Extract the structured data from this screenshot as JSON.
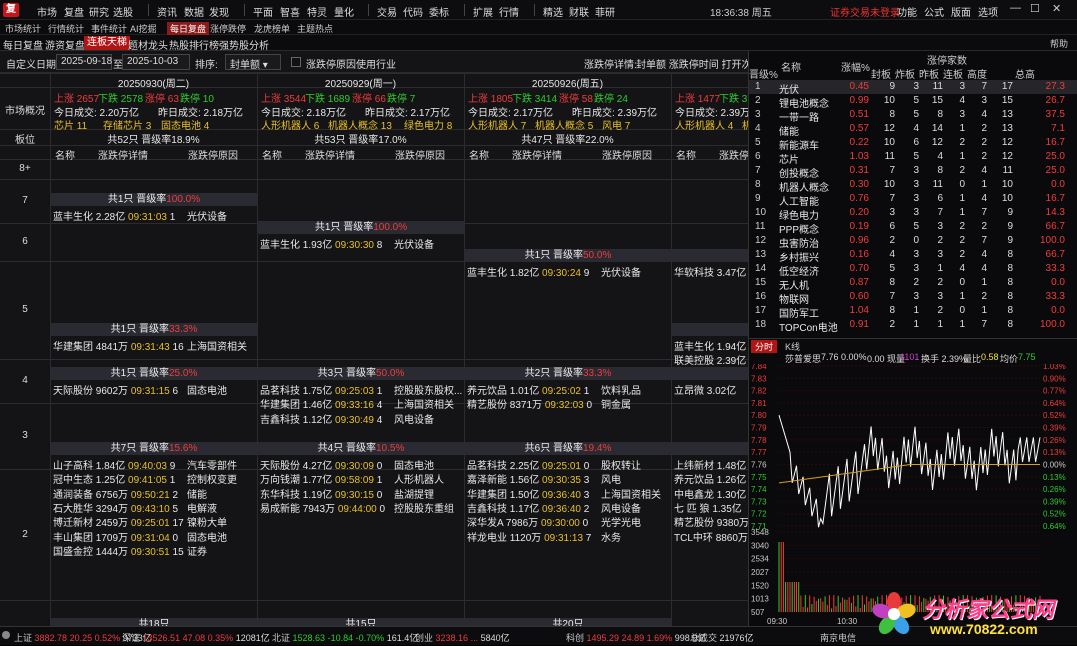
{
  "app": {
    "logo": "复"
  },
  "menubar": {
    "items": [
      "市场",
      "复盘",
      "研究",
      "选股",
      "资讯",
      "数据",
      "发现",
      "平面",
      "智喜",
      "特灵",
      "量化",
      "交易",
      "代码",
      "委标",
      "扩展",
      "行情",
      "精选",
      "财联",
      "菲研"
    ],
    "clock": "18:36:38 周五",
    "login": "证券交易未登录",
    "right": [
      "功能",
      "公式",
      "版面",
      "选项"
    ]
  },
  "subbar": {
    "items": [
      "市场统计",
      "行情统计",
      "事件统计",
      "AI挖掘",
      "每日复盘",
      "涨停跌停",
      "龙虎榜单",
      "主题热点"
    ],
    "active": 4
  },
  "tabbar": {
    "items": [
      "每日复盘",
      "游资复盘",
      "连板天梯",
      "题材龙头",
      "热股排行榜",
      "强势股分析"
    ],
    "active": 2,
    "help": "帮助"
  },
  "filter": {
    "date_label": "自定义日期",
    "start": "2025-09-18",
    "to": "至",
    "end": "2025-10-03",
    "sort_label": "排序:",
    "sort_value": "封单额",
    "chk_label": "涨跌停原因使用行业",
    "detail_label": "涨跌停详情:",
    "detail_opts": "封单额 涨跌停时间 打开次数"
  },
  "grid": {
    "row_labels": {
      "overview": "市场概况",
      "board": "板位",
      "b8": "8+",
      "b7": "7",
      "b6": "6",
      "b5": "5",
      "b4": "4",
      "b3": "3",
      "b2": "2"
    },
    "col_header": [
      "名称",
      "涨跌停详情",
      "涨跌停原因"
    ],
    "days": [
      {
        "date": "20250930(周二)",
        "up": "上涨 2657",
        "down": "下跌 2578",
        "zt": "涨停 63",
        "dt": "跌停 10",
        "vol": "今日成交: 2.20万亿",
        "pvol": "昨日成交: 2.18万亿",
        "themes": [
          "芯片 11",
          "存储芯片 3",
          "固态电池 4"
        ],
        "total": "共52只 晋级率18.9%"
      },
      {
        "date": "20250929(周一)",
        "up": "上涨 3544",
        "down": "下跌 1689",
        "zt": "涨停 66",
        "dt": "跌停 7",
        "vol": "今日成交: 2.18万亿",
        "pvol": "昨日成交: 2.17万亿",
        "themes": [
          "人形机器人 6",
          "机器人概念 13",
          "绿色电力 8"
        ],
        "total": "共53只 晋级率17.0%"
      },
      {
        "date": "20250926(周五)",
        "up": "上涨 1805",
        "down": "下跌 3414",
        "zt": "涨停 58",
        "dt": "跌停 24",
        "vol": "今日成交: 2.17万亿",
        "pvol": "昨日成交: 2.39万亿",
        "themes": [
          "人形机器人 7",
          "机器人概念 5",
          "风电 7"
        ],
        "total": "共47只 晋级率22.0%"
      },
      {
        "date": "20250925",
        "up": "上涨 1477",
        "down": "下跌 37",
        "zt": "",
        "dt": "",
        "vol": "今日成交: 2.39万亿",
        "pvol": "",
        "themes": [
          "人形机器人 4",
          "机器"
        ],
        "total": "共4"
      }
    ],
    "b7": [
      {
        "bar": "共1只 晋级率",
        "pct": "100.0%",
        "stocks": [
          {
            "n": "蓝丰生化",
            "a": "2.28亿",
            "t": "09:31:03",
            "o": "1",
            "r": "光伏设备"
          }
        ]
      }
    ],
    "b6": [
      {
        "bar": "共1只 晋级率",
        "pct": "100.0%",
        "stocks": [
          {
            "n": "蓝丰生化",
            "a": "1.93亿",
            "t": "09:30:30",
            "o": "8",
            "r": "光伏设备"
          }
        ]
      }
    ],
    "b5": [
      {
        "bar": "共1只 晋级率",
        "pct": "50.0%",
        "stocks": [
          {
            "n": "蓝丰生化",
            "a": "1.82亿",
            "t": "09:30:24",
            "o": "9",
            "r": "光伏设备"
          }
        ]
      },
      {
        "bar": "共",
        "stocks": [
          {
            "n": "华软科技",
            "a": "3.47亿",
            "t": "",
            "o": "",
            "r": ""
          }
        ]
      }
    ],
    "b4": [
      {
        "bar": "共1只 晋级率",
        "pct": "33.3%",
        "stocks": [
          {
            "n": "华建集团",
            "a": "4841万",
            "t": "09:31:43",
            "o": "16",
            "r": "上海国资相关"
          }
        ]
      },
      {
        "bar": "共",
        "stocks": [
          {
            "n": "蓝丰生化",
            "a": "1.94亿",
            "t": "",
            "o": "",
            "r": ""
          },
          {
            "n": "联美控股",
            "a": "2.39亿",
            "t": "",
            "o": "",
            "r": ""
          }
        ]
      }
    ],
    "b3": [
      {
        "bar": "共1只 晋级率",
        "pct": "25.0%",
        "stocks": [
          {
            "n": "天际股份",
            "a": "9602万",
            "t": "09:31:15",
            "o": "6",
            "r": "固态电池"
          }
        ]
      },
      {
        "bar": "共3只 晋级率",
        "pct": "50.0%",
        "stocks": [
          {
            "n": "品茗科技",
            "a": "1.75亿",
            "t": "09:25:03",
            "o": "1",
            "r": "控股股东股权..."
          },
          {
            "n": "华建集团",
            "a": "1.46亿",
            "t": "09:33:16",
            "o": "4",
            "r": "上海国资相关"
          },
          {
            "n": "吉鑫科技",
            "a": "1.12亿",
            "t": "09:30:49",
            "o": "4",
            "r": "风电设备"
          }
        ]
      },
      {
        "bar": "共2只 晋级率",
        "pct": "33.3%",
        "stocks": [
          {
            "n": "养元饮品",
            "a": "1.01亿",
            "t": "09:25:02",
            "o": "1",
            "r": "饮料乳品"
          },
          {
            "n": "精艺股份",
            "a": "8371万",
            "t": "09:32:03",
            "o": "0",
            "r": "铜金属"
          }
        ]
      },
      {
        "bar": "共",
        "stocks": [
          {
            "n": "立昂微",
            "a": "3.02亿",
            "t": "",
            "o": "",
            "r": ""
          }
        ]
      }
    ],
    "b2": [
      {
        "bar": "共7只 晋级率",
        "pct": "15.6%",
        "stocks": [
          {
            "n": "山子高科",
            "a": "1.84亿",
            "t": "09:40:03",
            "o": "9",
            "r": "汽车零部件"
          },
          {
            "n": "冠中生态",
            "a": "1.25亿",
            "t": "09:41:05",
            "o": "1",
            "r": "控制权变更"
          },
          {
            "n": "通润装备",
            "a": "6756万",
            "t": "09:50:21",
            "o": "2",
            "r": "储能"
          },
          {
            "n": "石大胜华",
            "a": "3294万",
            "t": "09:43:10",
            "o": "5",
            "r": "电解液"
          },
          {
            "n": "博迁新材",
            "a": "2459万",
            "t": "09:25:01",
            "o": "17",
            "r": "镍粉大单"
          },
          {
            "n": "丰山集团",
            "a": "1709万",
            "t": "09:31:04",
            "o": "0",
            "r": "固态电池"
          },
          {
            "n": "国盛金控",
            "a": "1444万",
            "t": "09:30:51",
            "o": "15",
            "r": "证券"
          }
        ]
      },
      {
        "bar": "共4只 晋级率",
        "pct": "10.5%",
        "stocks": [
          {
            "n": "天际股份",
            "a": "4.27亿",
            "t": "09:30:09",
            "o": "0",
            "r": "固态电池"
          },
          {
            "n": "万向钱潮",
            "a": "1.77亿",
            "t": "09:58:09",
            "o": "1",
            "r": "人形机器人"
          },
          {
            "n": "东华科技",
            "a": "1.19亿",
            "t": "09:30:15",
            "o": "0",
            "r": "盐湖提锂"
          },
          {
            "n": "易成新能",
            "a": "7943万",
            "t": "09:44:00",
            "o": "0",
            "r": "控股股东重组"
          }
        ]
      },
      {
        "bar": "共6只 晋级率",
        "pct": "19.4%",
        "stocks": [
          {
            "n": "品茗科技",
            "a": "2.25亿",
            "t": "09:25:01",
            "o": "0",
            "r": "股权转让"
          },
          {
            "n": "嘉泽新能",
            "a": "1.56亿",
            "t": "09:30:35",
            "o": "3",
            "r": "风电"
          },
          {
            "n": "华建集团",
            "a": "1.50亿",
            "t": "09:36:40",
            "o": "3",
            "r": "上海国资相关"
          },
          {
            "n": "吉鑫科技",
            "a": "1.17亿",
            "t": "09:36:40",
            "o": "2",
            "r": "风电设备"
          },
          {
            "n": "深华发A",
            "a": "7986万",
            "t": "09:30:00",
            "o": "0",
            "r": "光学光电"
          },
          {
            "n": "祥龙电业",
            "a": "1120万",
            "t": "09:31:13",
            "o": "7",
            "r": "水务"
          }
        ]
      },
      {
        "bar": "共",
        "stocks": [
          {
            "n": "上纬新材",
            "a": "1.48亿",
            "t": "",
            "o": "",
            "r": ""
          },
          {
            "n": "养元饮品",
            "a": "1.26亿",
            "t": "",
            "o": "",
            "r": ""
          },
          {
            "n": "中电鑫龙",
            "a": "1.30亿",
            "t": "",
            "o": "",
            "r": ""
          },
          {
            "n": "七 匹 狼",
            "a": "1.35亿",
            "t": "",
            "o": "",
            "r": ""
          },
          {
            "n": "精艺股份",
            "a": "9380万",
            "t": "",
            "o": "",
            "r": ""
          },
          {
            "n": "TCL中环",
            "a": "8860万",
            "t": "",
            "o": "",
            "r": ""
          }
        ]
      }
    ],
    "bottom_bars": [
      "共18只",
      "共15只",
      "共20只"
    ]
  },
  "right_table": {
    "group": "涨停家数",
    "headers": [
      "名称",
      "涨幅%",
      "封板",
      "炸板",
      "昨板",
      "连板",
      "高度",
      "总高",
      "晋级%"
    ],
    "rows": [
      [
        "1",
        "光伏",
        "0.45",
        "9",
        "3",
        "11",
        "3",
        "7",
        "17",
        "27.3"
      ],
      [
        "2",
        "锂电池概念",
        "0.99",
        "10",
        "5",
        "15",
        "4",
        "3",
        "15",
        "26.7"
      ],
      [
        "3",
        "一带一路",
        "0.51",
        "8",
        "5",
        "8",
        "3",
        "4",
        "13",
        "37.5"
      ],
      [
        "4",
        "储能",
        "0.57",
        "12",
        "4",
        "14",
        "1",
        "2",
        "13",
        "7.1"
      ],
      [
        "5",
        "新能源车",
        "0.22",
        "10",
        "6",
        "12",
        "2",
        "2",
        "12",
        "16.7"
      ],
      [
        "6",
        "芯片",
        "1.03",
        "11",
        "5",
        "4",
        "1",
        "2",
        "12",
        "25.0"
      ],
      [
        "7",
        "创投概念",
        "0.31",
        "7",
        "3",
        "8",
        "2",
        "4",
        "11",
        "25.0"
      ],
      [
        "8",
        "机器人概念",
        "0.30",
        "10",
        "3",
        "11",
        "0",
        "1",
        "10",
        "0.0"
      ],
      [
        "9",
        "人工智能",
        "0.76",
        "7",
        "3",
        "6",
        "1",
        "4",
        "10",
        "16.7"
      ],
      [
        "10",
        "绿色电力",
        "0.20",
        "3",
        "3",
        "7",
        "1",
        "7",
        "9",
        "14.3"
      ],
      [
        "11",
        "PPP概念",
        "0.19",
        "6",
        "5",
        "3",
        "2",
        "2",
        "9",
        "66.7"
      ],
      [
        "12",
        "虫害防治",
        "0.96",
        "2",
        "0",
        "2",
        "2",
        "7",
        "9",
        "100.0"
      ],
      [
        "13",
        "乡村振兴",
        "0.16",
        "4",
        "3",
        "3",
        "2",
        "4",
        "8",
        "66.7"
      ],
      [
        "14",
        "低空经济",
        "0.70",
        "5",
        "3",
        "1",
        "4",
        "4",
        "8",
        "33.3"
      ],
      [
        "15",
        "无人机",
        "0.87",
        "8",
        "2",
        "2",
        "0",
        "1",
        "8",
        "0.0"
      ],
      [
        "16",
        "物联网",
        "0.60",
        "7",
        "3",
        "3",
        "1",
        "2",
        "8",
        "33.3"
      ],
      [
        "17",
        "国防军工",
        "1.04",
        "8",
        "1",
        "2",
        "0",
        "1",
        "8",
        "0.0"
      ],
      [
        "18",
        "TOPCon电池",
        "0.91",
        "2",
        "1",
        "1",
        "1",
        "7",
        "8",
        "100.0"
      ]
    ]
  },
  "chart": {
    "tabs": [
      "分时",
      "K线"
    ],
    "info_name": "莎普爱思",
    "info_price": "7.76",
    "info_chg": "0.00%",
    "info_vol_label": "0.00 现量",
    "info_vol": "1101",
    "info_turn": "换手 2.39%",
    "info_ratio_label": "量比",
    "info_ratio": "0.58",
    "info_avg_label": "均价",
    "info_avg": "7.75",
    "price_ticks": [
      "7.84",
      "7.83",
      "7.82",
      "7.81",
      "7.80",
      "7.79",
      "7.78",
      "7.77",
      "7.76",
      "7.75",
      "7.74",
      "7.73",
      "7.72",
      "7.71"
    ],
    "pct_ticks": [
      "1.03%",
      "0.90%",
      "0.77%",
      "0.64%",
      "0.52%",
      "0.39%",
      "0.26%",
      "0.13%",
      "0.00%",
      "0.13%",
      "0.26%",
      "0.39%",
      "0.52%",
      "0.64%"
    ],
    "vol_ticks": [
      "3548",
      "3040",
      "2534",
      "2027",
      "1520",
      "1013",
      "507"
    ],
    "time_ticks": [
      "09:30",
      "10:30"
    ]
  },
  "statusbar": [
    {
      "l": "上证",
      "v": "3882.78",
      "c": "20.25",
      "p": "0.52%",
      "a": "9733亿",
      "col": "up"
    },
    {
      "l": "深证",
      "v": "13526.51",
      "c": "47.08",
      "p": "0.35%",
      "a": "12081亿",
      "col": "up"
    },
    {
      "l": "北证",
      "v": "1528.63",
      "c": "-10.84",
      "p": "-0.70%",
      "a": "161.4亿",
      "col": "down"
    },
    {
      "l": "创业",
      "v": "3238.16",
      "c": "...",
      "p": "",
      "a": "5840亿",
      "col": "up"
    },
    {
      "l": "科创",
      "v": "1495.29",
      "c": "24.89",
      "p": "1.69%",
      "a": "998.0亿",
      "col": "up"
    },
    {
      "l": "总成交",
      "v": "",
      "c": "",
      "p": "",
      "a": "21976亿",
      "col": "up"
    },
    {
      "l": "南京电信",
      "v": "",
      "c": "",
      "p": "",
      "a": "",
      "col": "up"
    }
  ],
  "watermark": {
    "title": "分析家公式网",
    "url": "www.70822.com"
  },
  "colors": {
    "up": "#f03c3c",
    "down": "#2ecc2e",
    "accent": "#b01515",
    "time": "#e8c02a"
  }
}
